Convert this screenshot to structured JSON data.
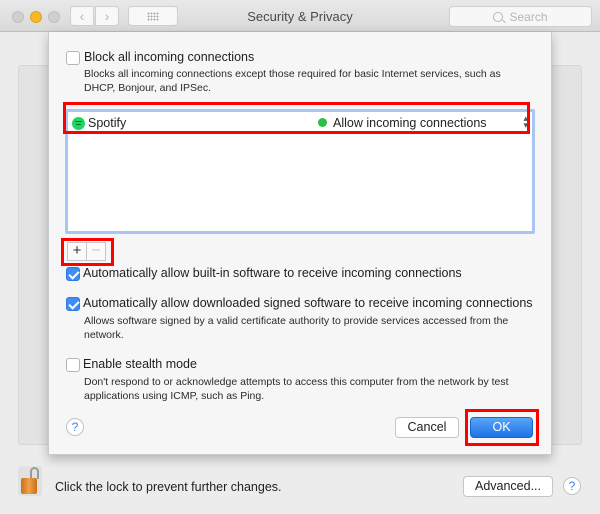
{
  "window": {
    "title": "Security & Privacy",
    "search_placeholder": "Search",
    "back_glyph": "‹",
    "forward_glyph": "›"
  },
  "sheet": {
    "block_all": {
      "label": "Block all incoming connections",
      "checked": false,
      "description": "Blocks all incoming connections except those required for basic Internet services, such as DHCP, Bonjour, and IPSec."
    },
    "app_list": [
      {
        "name": "Spotify",
        "icon": "spotify-icon",
        "status": "Allow incoming connections",
        "status_color": "#2bbd45"
      }
    ],
    "add_label": "+",
    "remove_label": "−",
    "auto_builtin": {
      "label": "Automatically allow built-in software to receive incoming connections",
      "checked": true
    },
    "auto_signed": {
      "label": "Automatically allow downloaded signed software to receive incoming connections",
      "checked": true,
      "description": "Allows software signed by a valid certificate authority to provide services accessed from the network."
    },
    "stealth": {
      "label": "Enable stealth mode",
      "checked": false,
      "description": "Don't respond to or acknowledge attempts to access this computer from the network by test applications using ICMP, such as Ping."
    },
    "help_label": "?",
    "cancel_label": "Cancel",
    "ok_label": "OK"
  },
  "footer": {
    "lock_text": "Click the lock to prevent further changes.",
    "advanced_label": "Advanced...",
    "help_label": "?"
  },
  "colors": {
    "accent": "#1e72e6",
    "highlight": "#ff0000"
  }
}
